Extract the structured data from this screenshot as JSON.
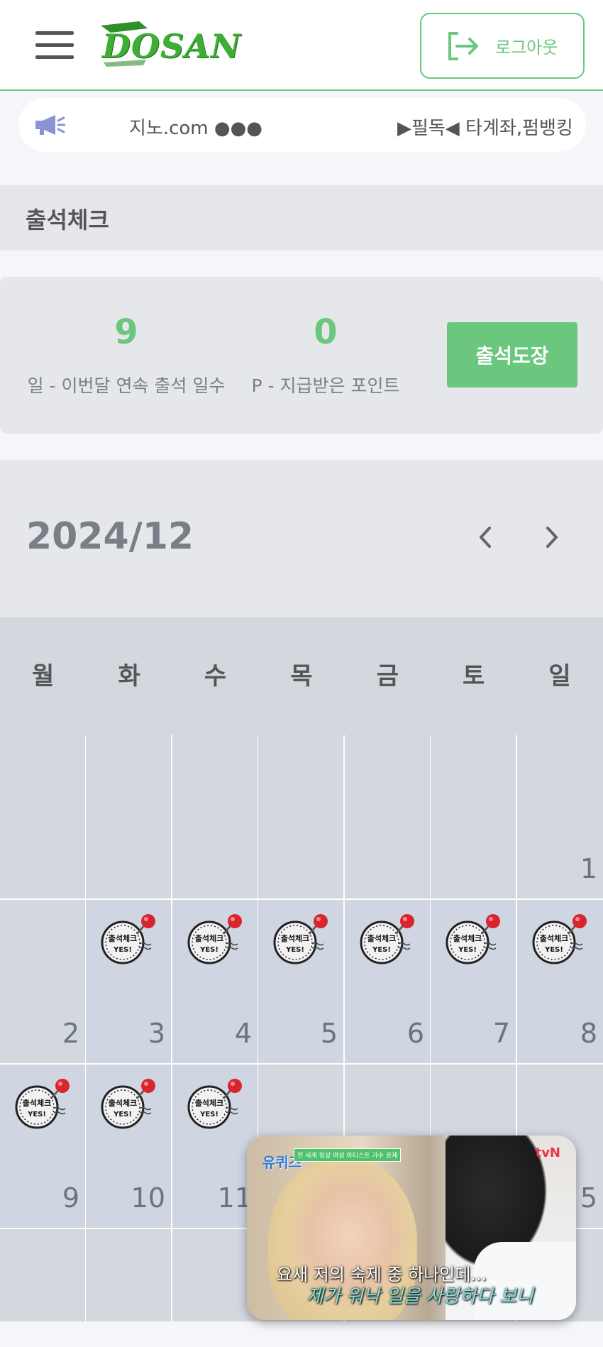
{
  "header": {
    "logo_text": "DOSAN",
    "logout_label": "로그아웃"
  },
  "notice": {
    "text_left": "지노.com ●●●",
    "text_right": "▶필독◀ 타계좌,펌뱅킹"
  },
  "page": {
    "title": "출석체크"
  },
  "stats": {
    "streak_value": "9",
    "streak_label": "일 - 이번달 연속 출석 일수",
    "points_value": "0",
    "points_label": "P - 지급받은 포인트",
    "stamp_button": "출석도장"
  },
  "calendar": {
    "month": "2024/12",
    "weekdays": [
      "월",
      "화",
      "수",
      "목",
      "금",
      "토",
      "일"
    ],
    "stamp_text": "출석체크",
    "stamp_sub": "YES!",
    "days": [
      "1",
      "2",
      "3",
      "4",
      "5",
      "6",
      "7",
      "8",
      "9",
      "10",
      "11",
      "5"
    ],
    "attended_days": [
      3,
      4,
      5,
      6,
      7,
      8,
      9,
      10,
      11
    ]
  },
  "video": {
    "show_logo": "유퀴즈",
    "caption": "전 세계 정상 여성 아티스트 가수 로제",
    "channel": "tvN",
    "subtitle_1": "요새 저의 숙제 중 하나인데...",
    "subtitle_2": "제가 워낙 일을 사랑하다 보니"
  },
  "colors": {
    "accent": "#6cc77e",
    "background": "#f5f6fa",
    "panel": "#e5e7eb",
    "calendar_cell": "#d3d7de"
  }
}
